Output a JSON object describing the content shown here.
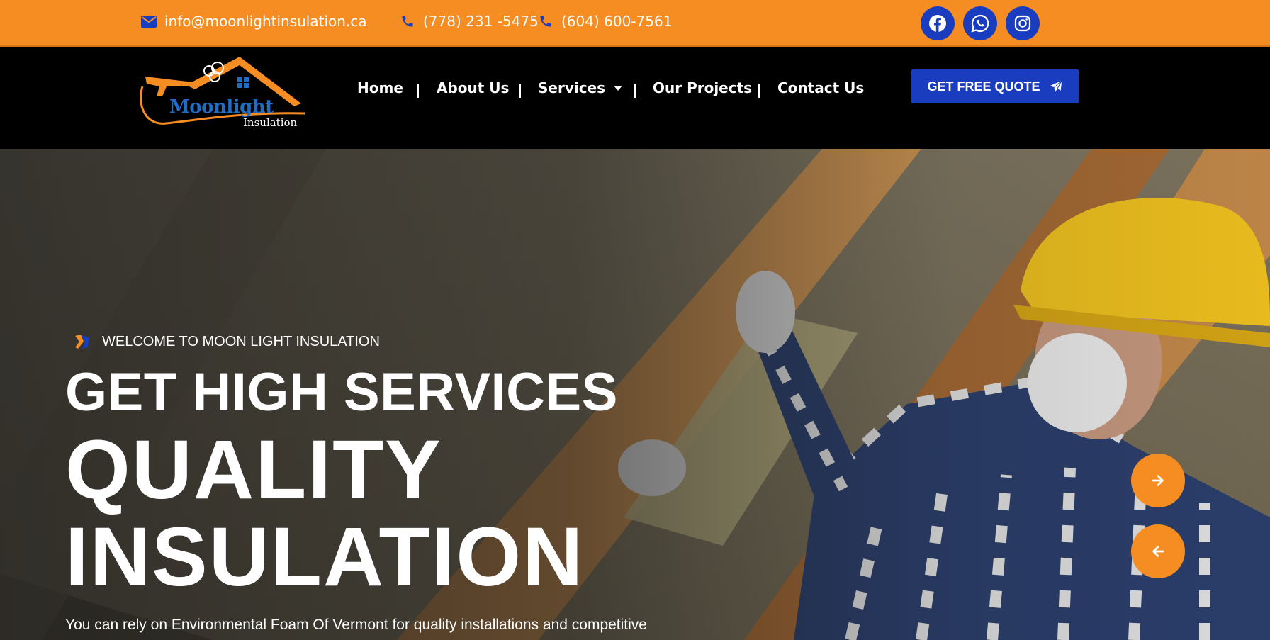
{
  "topbar": {
    "email": "info@moonlightinsulation.ca",
    "phone1": "(778) 231 -5475",
    "phone2": "(604) 600-7561",
    "icons": [
      "envelope-icon",
      "phone-icon",
      "phone-icon",
      "facebook-icon",
      "whatsapp-icon",
      "instagram-icon"
    ],
    "background_color": "#f68d22",
    "icon_color": "#1a3dbf"
  },
  "header": {
    "logo": {
      "name": "Moonlight",
      "sub": "Insulation"
    },
    "nav": {
      "home": "Home",
      "about": "About Us",
      "services": "Services",
      "projects": "Our Projects",
      "contact": "Contact Us"
    },
    "quote_button": "GET FREE QUOTE",
    "accent_color": "#1a3dbf"
  },
  "hero": {
    "welcome": "WELCOME TO MOON LIGHT INSULATION",
    "line1": "GET HIGH SERVICES",
    "line2": "QUALITY",
    "line3": "INSULATION",
    "description": "You can rely on Environmental Foam Of Vermont for quality installations and competitive",
    "arrow_color": "#f68d22"
  }
}
